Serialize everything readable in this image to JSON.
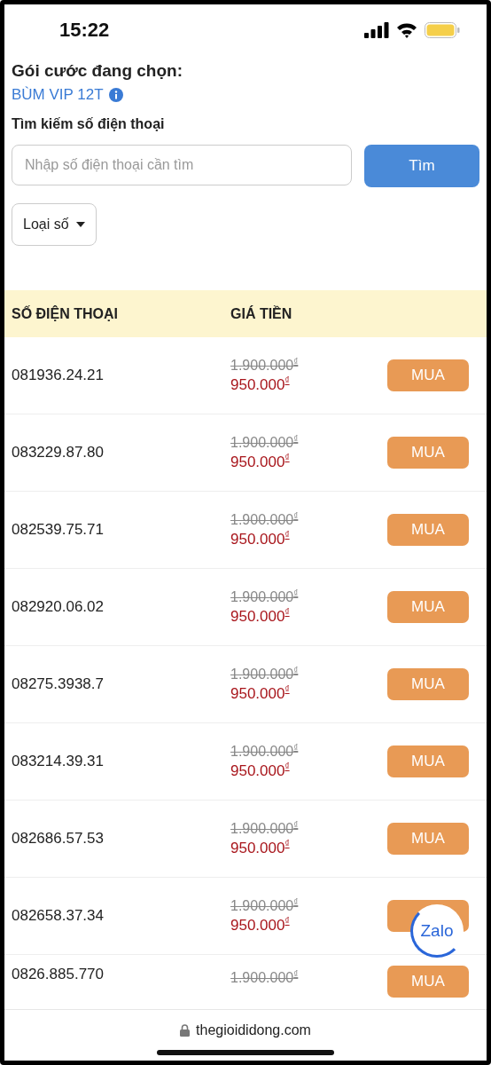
{
  "status_bar": {
    "time": "15:22"
  },
  "plan": {
    "label": "Gói cước đang chọn:",
    "name": "BÙM VIP 12T"
  },
  "search": {
    "label": "Tìm kiếm số điện thoại",
    "placeholder": "Nhập số điện thoại cần tìm",
    "button": "Tìm"
  },
  "filter": {
    "label": "Loại số"
  },
  "table": {
    "columns": [
      "SỐ ĐIỆN THOẠI",
      "GIÁ TIỀN"
    ],
    "rows": [
      {
        "number": "081936.24.21",
        "old_price": "1.900.000$^{₫}$",
        "price": "950.000$^{₫}$",
        "button": "MUA"
      },
      {
        "number": "083229.87.80",
        "old_price": "1.900.000$^{₫}$",
        "price": "950.000$^{₫}$",
        "button": "MUA"
      },
      {
        "number": "082539.75.71",
        "old_price": "1.900.000$^{₫}$",
        "price": "950.000$^{₫}$",
        "button": "MUA"
      },
      {
        "number": "082920.06.02",
        "old_price": "1.900.000$^{₫}$",
        "price": "950.000$^{₫}$",
        "button": "MUA"
      },
      {
        "number": "08275.3938.7",
        "old_price": "1.900.000$^{₫}$",
        "price": "950.000$^{₫}$",
        "button": "MUA"
      },
      {
        "number": "083214.39.31",
        "old_price": "1.900.000$^{₫}$",
        "price": "950.000$^{₫}$",
        "button": "MUA"
      },
      {
        "number": "082686.57.53",
        "old_price": "1.900.000$^{₫}$",
        "price": "950.000$^{₫}$",
        "button": "MUA"
      },
      {
        "number": "082658.37.34",
        "old_price": "1.900.000$^{₫}$",
        "price": "950.000$^{₫}$"
      },
      {
        "number": "0826.885.770",
        "old_price": "1.900.000$^{₫}$",
        "button": "MUA"
      }
    ]
  },
  "chat_button": {
    "label": "Zalo"
  },
  "browser_bar": {
    "url": "thegioididong.com"
  }
}
